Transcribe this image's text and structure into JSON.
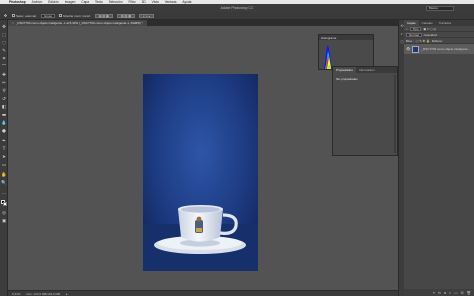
{
  "menubar": {
    "apple": "",
    "items": [
      "Photoshop",
      "Archivo",
      "Edición",
      "Imagen",
      "Capa",
      "Texto",
      "Selección",
      "Filtro",
      "3D",
      "Vista",
      "Ventana",
      "Ayuda"
    ]
  },
  "app": {
    "title": "Adobe Photoshop CC",
    "workspace": "Básico"
  },
  "options": {
    "tool_label": "Selec. automát.",
    "tool_value": "Grupo",
    "transform_label": "Mostrar contr. transf."
  },
  "document": {
    "tab_title": "_DSC7700 como objeto inteligente -1 al 8,33% (_DSC7700 como objeto inteligente-1, RGB/8) *",
    "tab_close": "×",
    "status": "Doc: 103,6 MB/103,6 MB",
    "zoom": "8,33%"
  },
  "histogram": {
    "tab": "Histograma",
    "warning": "▲"
  },
  "properties": {
    "tabs": [
      "Propiedades",
      "Información"
    ],
    "body": "Sin propiedades"
  },
  "layers_panel": {
    "tabs": [
      "Capas",
      "Canales",
      "Trazados"
    ],
    "filter_label": "Tipo",
    "blend_mode": "Normal",
    "opacity_label": "Opacidad:",
    "lock_label": "Bloq.:",
    "fill_label": "Relleno:",
    "layer_name": "_DSC7700 como objeto inteligente..."
  },
  "colors": {
    "canvas_bg": "#535353",
    "photo_bg": "#1e3a7d",
    "panel": "#474747"
  }
}
